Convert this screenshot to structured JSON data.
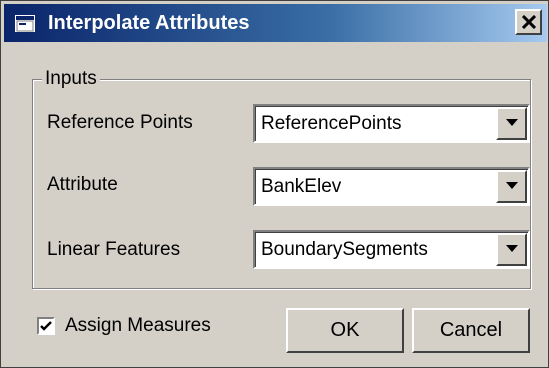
{
  "window": {
    "title": "Interpolate Attributes",
    "close_label": "close"
  },
  "inputs_group": {
    "label": "Inputs",
    "fields": [
      {
        "label": "Reference Points",
        "value": "ReferencePoints"
      },
      {
        "label": "Attribute",
        "value": "BankElev"
      },
      {
        "label": "Linear Features",
        "value": "BoundarySegments"
      }
    ]
  },
  "options": {
    "assign_measures_label": "Assign Measures",
    "assign_measures_checked": true
  },
  "buttons": {
    "ok_label": "OK",
    "cancel_label": "Cancel"
  },
  "icons": {
    "app": "app-window-icon",
    "close": "close-icon",
    "dropdown": "chevron-down-icon",
    "check": "checkmark-icon"
  },
  "colors": {
    "title_bar_start": "#0a246a",
    "title_bar_end": "#a6caf0",
    "dialog_face": "#d4d0c8"
  }
}
